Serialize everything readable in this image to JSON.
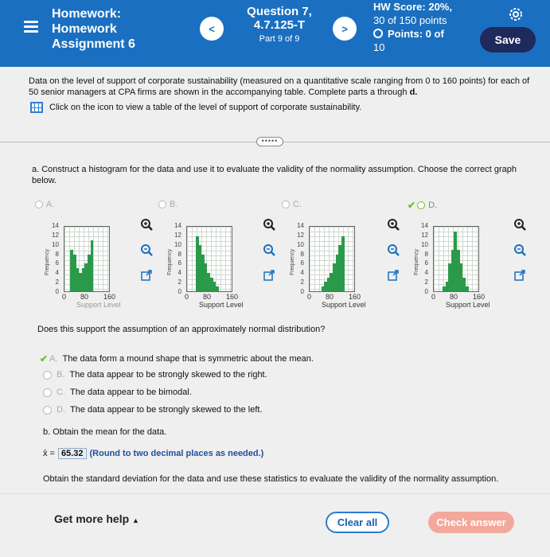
{
  "header": {
    "title_lines": [
      "Homework:",
      "Homework",
      "Assignment 6"
    ],
    "question_title_lines": [
      "Question 7,",
      "4.7.125-T"
    ],
    "part": "Part 9 of 9",
    "hw_score_lines": [
      "HW Score: 20%,",
      "30 of 150 points"
    ],
    "points": "Points: 0 of",
    "points_total": "10",
    "save_label": "Save"
  },
  "intro": {
    "text": "Data on the level of support of corporate sustainability (measured on a quantitative scale ranging from 0 to 160 points) for each of 50 senior managers at CPA firms are shown in the accompanying table. Complete parts a through",
    "bold_end": "d.",
    "table_link": "Click on the icon to view a table of the level of support of corporate sustainability."
  },
  "part_a": "a. Construct a histogram for the data and use it to evaluate the validity of the normality assumption. Choose the correct graph below.",
  "options": [
    {
      "label": "A."
    },
    {
      "label": "B."
    },
    {
      "label": "C."
    },
    {
      "label": "D."
    }
  ],
  "chart_common": {
    "ylabel": "Frequency",
    "xlabel": "Support Level",
    "yticks": [
      "14",
      "12",
      "10",
      "8",
      "6",
      "4",
      "2",
      "0"
    ],
    "xticks": [
      "0",
      "80",
      "160"
    ]
  },
  "chart_data": [
    {
      "type": "bar",
      "x": [
        0,
        10,
        20,
        30,
        40,
        50,
        60,
        70,
        80,
        90,
        100,
        110,
        120,
        130,
        140,
        150
      ],
      "values": [
        0,
        0,
        9,
        8,
        5,
        4,
        5,
        6,
        8,
        11,
        0,
        0,
        0,
        0,
        0,
        0
      ],
      "ylim": [
        0,
        14
      ],
      "xlim": [
        0,
        160
      ]
    },
    {
      "type": "bar",
      "x": [
        0,
        10,
        20,
        30,
        40,
        50,
        60,
        70,
        80,
        90,
        100,
        110,
        120,
        130,
        140,
        150
      ],
      "values": [
        0,
        0,
        0,
        12,
        10,
        8,
        6,
        4,
        3,
        2,
        1,
        0,
        0,
        0,
        0,
        0
      ],
      "ylim": [
        0,
        14
      ],
      "xlim": [
        0,
        160
      ]
    },
    {
      "type": "bar",
      "x": [
        0,
        10,
        20,
        30,
        40,
        50,
        60,
        70,
        80,
        90,
        100,
        110,
        120,
        130,
        140,
        150
      ],
      "values": [
        0,
        0,
        0,
        0,
        1,
        2,
        3,
        4,
        6,
        8,
        10,
        12,
        0,
        0,
        0,
        0
      ],
      "ylim": [
        0,
        14
      ],
      "xlim": [
        0,
        160
      ]
    },
    {
      "type": "bar",
      "x": [
        0,
        10,
        20,
        30,
        40,
        50,
        60,
        70,
        80,
        90,
        100,
        110,
        120,
        130,
        140,
        150
      ],
      "values": [
        0,
        0,
        0,
        1,
        2,
        6,
        9,
        13,
        9,
        6,
        3,
        1,
        0,
        0,
        0,
        0
      ],
      "ylim": [
        0,
        14
      ],
      "xlim": [
        0,
        160
      ]
    }
  ],
  "q2": "Does this support the assumption of an approximately normal distribution?",
  "choices": [
    {
      "letter": "A.",
      "text": "The data form a mound shape that is symmetric about the mean."
    },
    {
      "letter": "B.",
      "text": "The data appear to be strongly skewed to the right."
    },
    {
      "letter": "C.",
      "text": "The data appear to be bimodal."
    },
    {
      "letter": "D.",
      "text": "The data appear to be strongly skewed to the left."
    }
  ],
  "part_b": "b. Obtain the mean for the data.",
  "mean": {
    "symbol": "x̄ =",
    "value": "65.32",
    "note": "(Round to two decimal places as needed.)"
  },
  "sd_prompt": "Obtain the standard deviation for the data and use these statistics to evaluate the validity of the normality assumption.",
  "footer": {
    "help": "Get more help",
    "clear": "Clear all",
    "check": "Check answer"
  },
  "colors": {
    "header": "#1a6fc0",
    "bar": "#2a9a4a",
    "check": "#6fbf2a",
    "check_button": "#f3a89b"
  }
}
